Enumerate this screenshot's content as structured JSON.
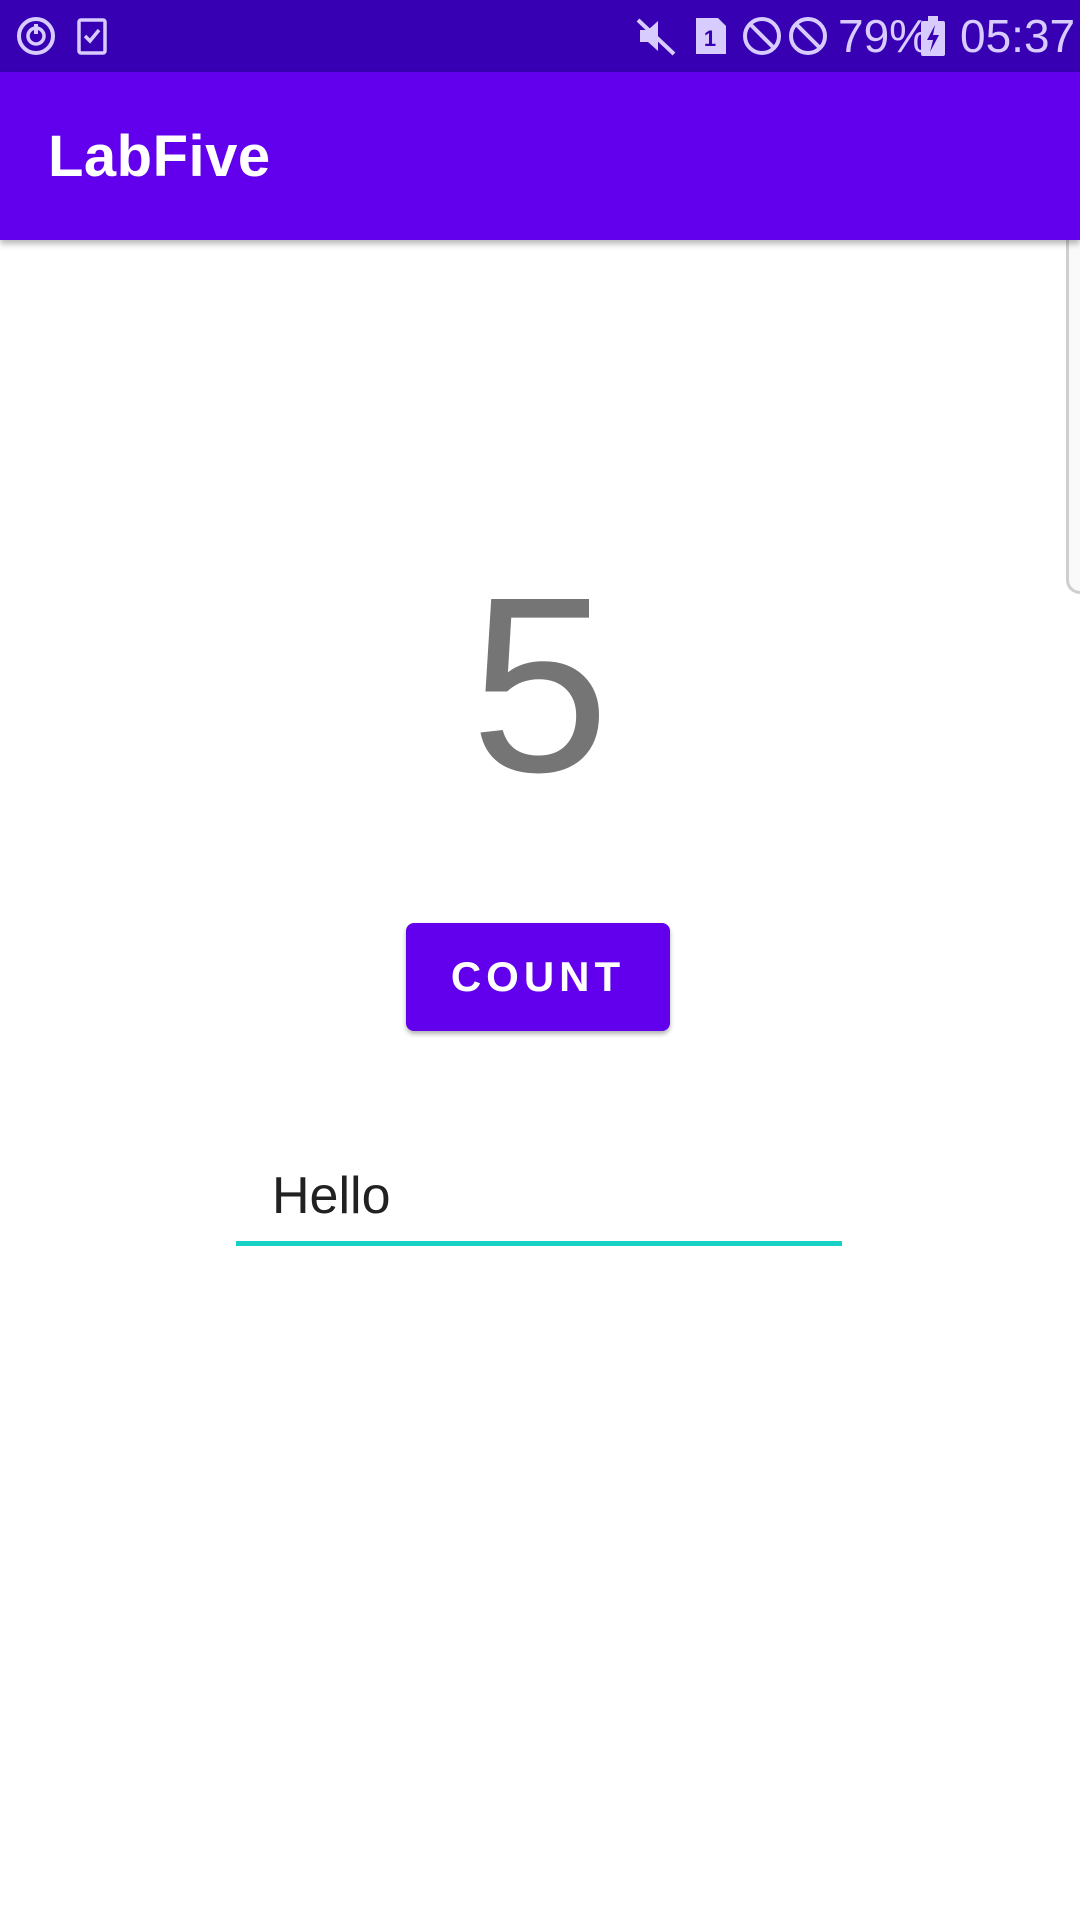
{
  "status_bar": {
    "battery_percent": "79%",
    "time": "05:37",
    "icons": [
      "sync-icon",
      "task-check-icon",
      "mute-icon",
      "sim-1-icon",
      "do-not-disturb-icon",
      "blocked-icon",
      "battery-charging-icon"
    ],
    "sim_number": "1"
  },
  "app_bar": {
    "title": "LabFive"
  },
  "main": {
    "count_value": "5",
    "count_button_label": "COUNT",
    "text_input_value": "Hello"
  },
  "colors": {
    "status_bar": "#3700B3",
    "primary": "#6200EE",
    "accent_underline": "#18D1C6",
    "count_text": "#757575"
  }
}
